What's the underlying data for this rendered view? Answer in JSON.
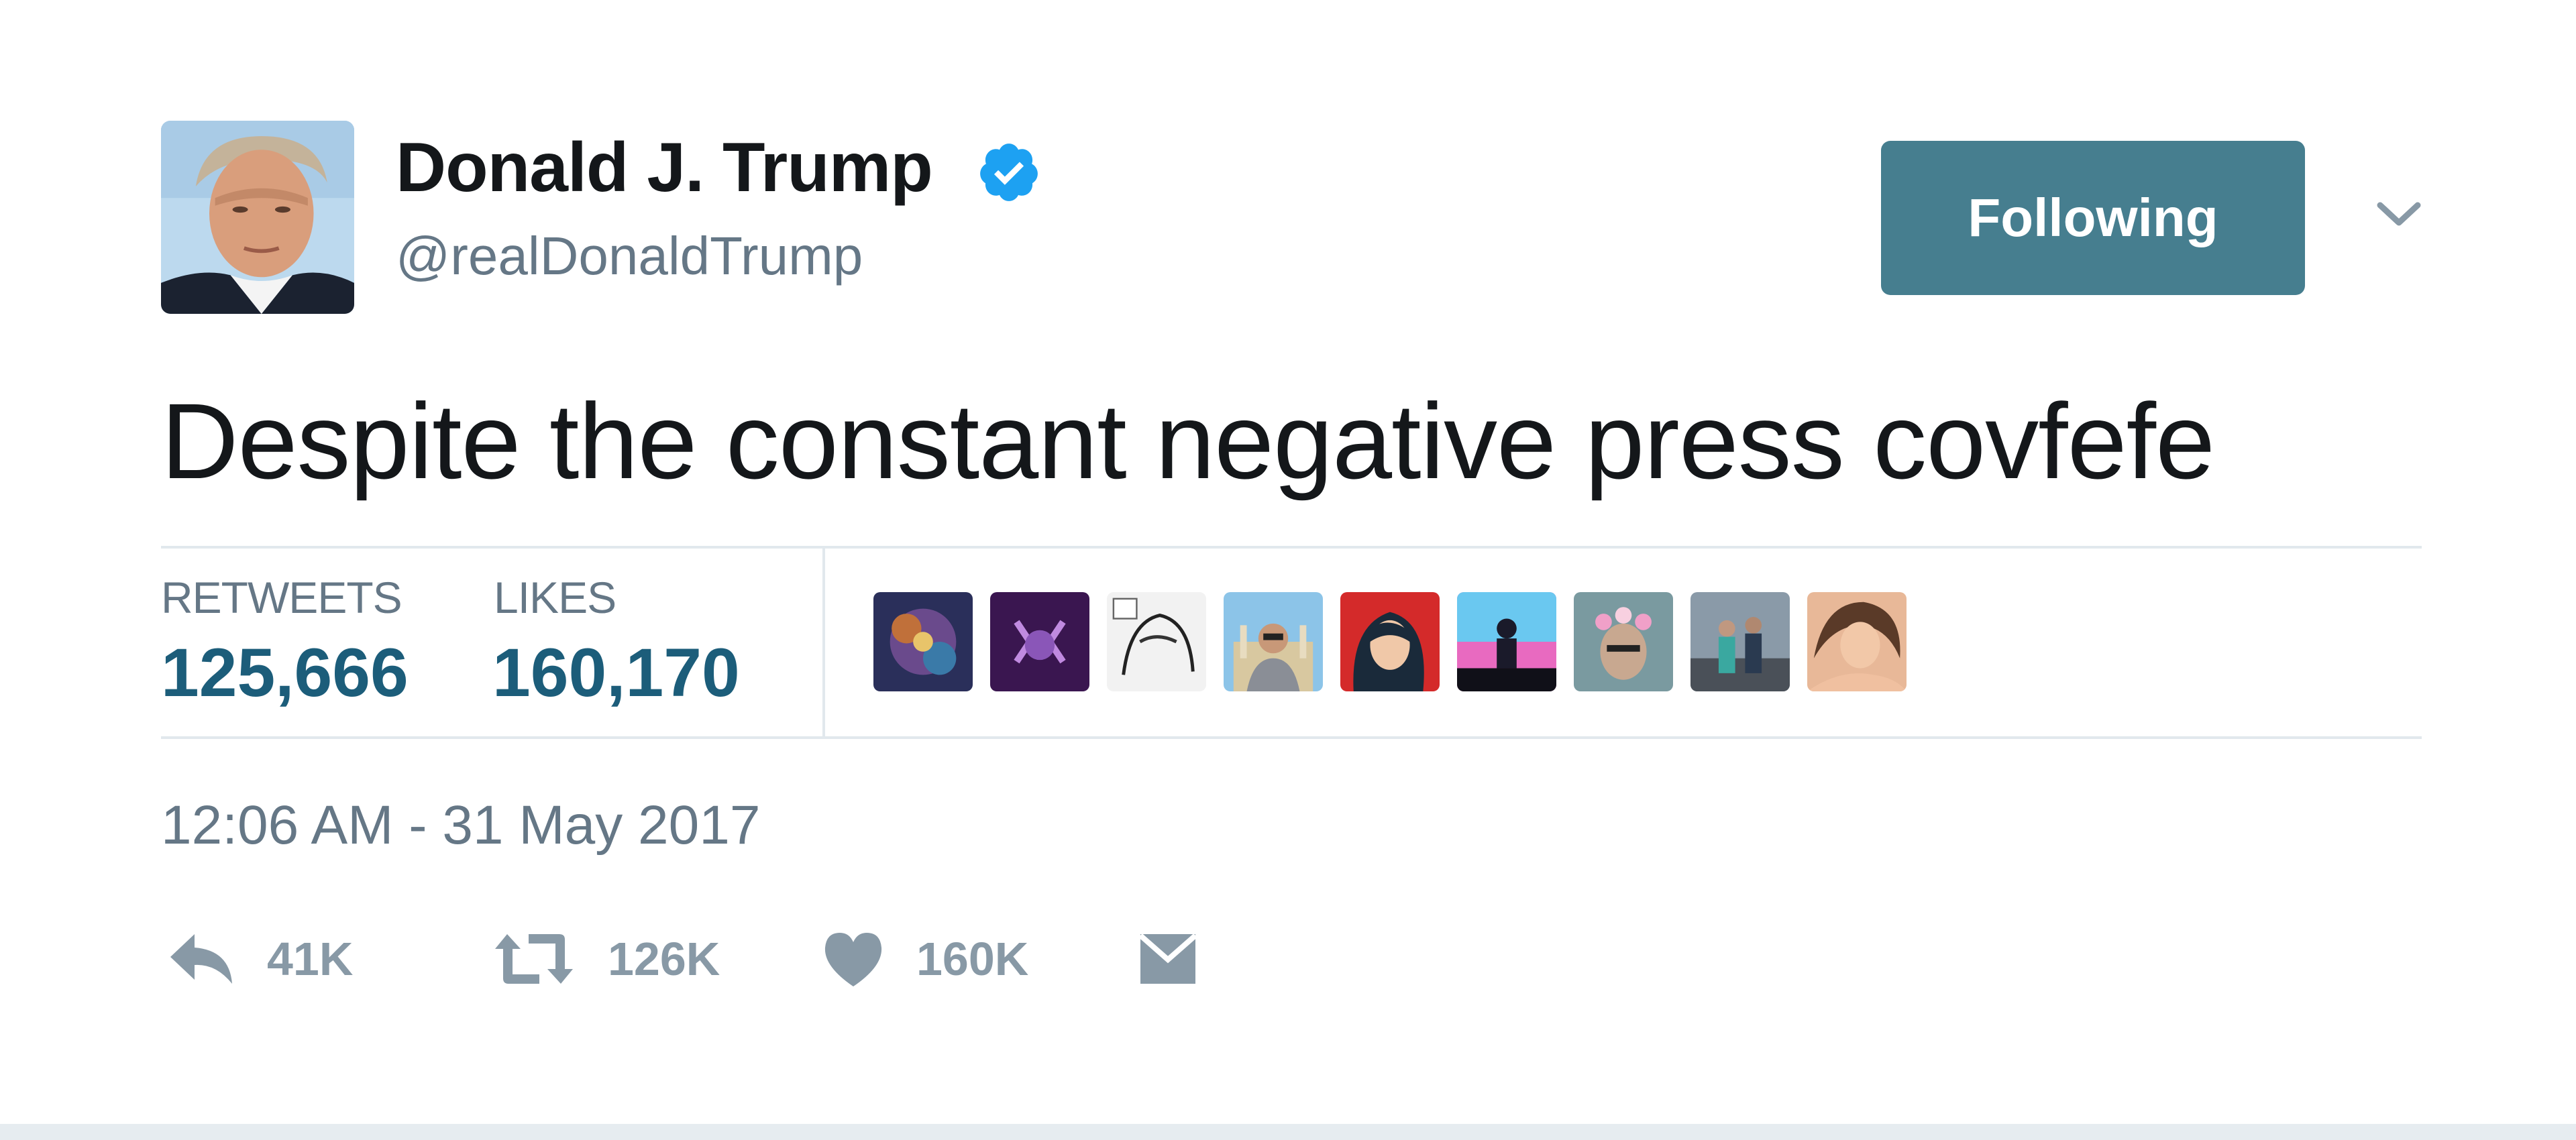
{
  "tweet": {
    "author": {
      "display_name": "Donald J. Trump",
      "handle": "@realDonaldTrump",
      "verified": true
    },
    "follow_button_label": "Following",
    "text": "Despite the constant negative press covfefe",
    "stats": {
      "retweets_label": "RETWEETS",
      "retweets_value": "125,666",
      "likes_label": "LIKES",
      "likes_value": "160,170",
      "liker_avatars": [
        "liker-avatar-galaxy",
        "liker-avatar-purple-emblem",
        "liker-avatar-manga",
        "liker-avatar-ruins-man",
        "liker-avatar-red-portrait",
        "liker-avatar-stage",
        "liker-avatar-flower-crown",
        "liker-avatar-group",
        "liker-avatar-woman"
      ]
    },
    "timestamp": "12:06 AM - 31 May 2017",
    "actions": {
      "reply_count": "41K",
      "retweet_count": "126K",
      "like_count": "160K"
    }
  },
  "colors": {
    "accent": "#467e8f",
    "stat_value": "#1c5d7a",
    "verified_blue": "#1da1f2",
    "muted_text": "#657786",
    "action_gray": "#8899a6"
  },
  "icons": [
    "verified-badge-icon",
    "chevron-down-icon",
    "reply-icon",
    "retweet-icon",
    "heart-icon",
    "envelope-icon"
  ]
}
